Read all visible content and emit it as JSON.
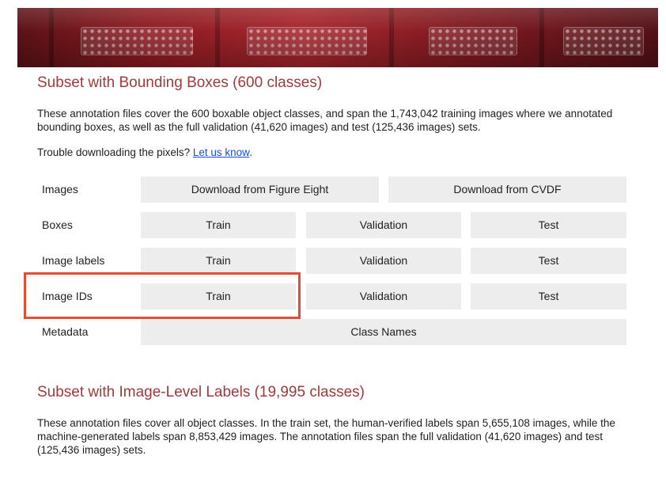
{
  "section1": {
    "title": "Subset with Bounding Boxes (600 classes)",
    "description": "These annotation files cover the 600 boxable object classes, and span the 1,743,042 training images where we annotated bounding boxes, as well as the full validation (41,620 images) and test (125,436 images) sets.",
    "trouble_prefix": "Trouble downloading the pixels? ",
    "trouble_link": "Let us know",
    "trouble_suffix": "."
  },
  "rows": {
    "images": {
      "label": "Images",
      "btn1": "Download from Figure Eight",
      "btn2": "Download from CVDF"
    },
    "boxes": {
      "label": "Boxes",
      "train": "Train",
      "validation": "Validation",
      "test": "Test"
    },
    "image_labels": {
      "label": "Image labels",
      "train": "Train",
      "validation": "Validation",
      "test": "Test"
    },
    "image_ids": {
      "label": "Image IDs",
      "train": "Train",
      "validation": "Validation",
      "test": "Test"
    },
    "metadata": {
      "label": "Metadata",
      "class_names": "Class Names"
    }
  },
  "section2": {
    "title": "Subset with Image-Level Labels (19,995 classes)",
    "description": "These annotation files cover all object classes. In the train set, the human-verified labels span 5,655,108 images, while the machine-generated labels span 8,853,429 images. The annotation files span the full validation (41,620 images) and test (125,436 images) sets."
  },
  "colors": {
    "title": "#a03a3a",
    "button_bg": "#ededed",
    "highlight": "#e24d35",
    "link": "#1a4fd6"
  }
}
